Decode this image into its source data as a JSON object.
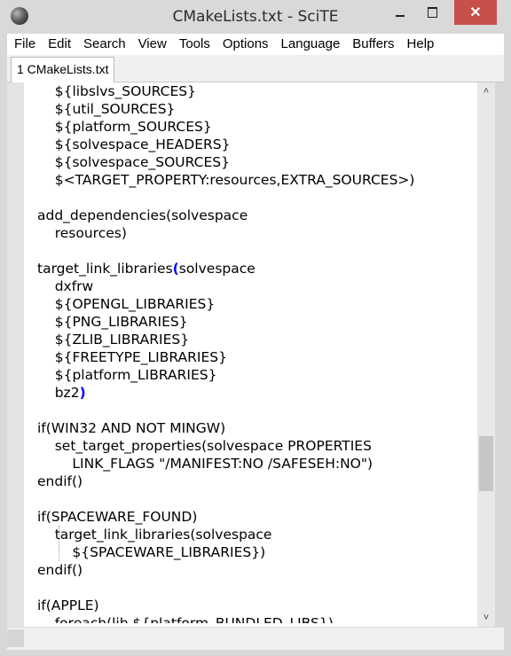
{
  "window": {
    "title": "CMakeLists.txt - SciTE",
    "close_glyph": "✕"
  },
  "menu": [
    "File",
    "Edit",
    "Search",
    "View",
    "Tools",
    "Options",
    "Language",
    "Buffers",
    "Help"
  ],
  "tabs": [
    {
      "label": "1 CMakeLists.txt",
      "active": true
    }
  ],
  "colors": {
    "brace_highlight": "#0000ff",
    "close_button": "#c7504b",
    "margin": "#e4e4e4"
  },
  "editor": {
    "lines": [
      {
        "indent": "    ",
        "text": "${libslvs_SOURCES}"
      },
      {
        "indent": "    ",
        "text": "${util_SOURCES}"
      },
      {
        "indent": "    ",
        "text": "${platform_SOURCES}"
      },
      {
        "indent": "    ",
        "text": "${solvespace_HEADERS}"
      },
      {
        "indent": "    ",
        "text": "${solvespace_SOURCES}"
      },
      {
        "indent": "    ",
        "text": "$<TARGET_PROPERTY:resources,EXTRA_SOURCES>)"
      },
      {
        "indent": "",
        "text": ""
      },
      {
        "indent": "",
        "text": "add_dependencies(solvespace"
      },
      {
        "indent": "    ",
        "text": "resources)"
      },
      {
        "indent": "",
        "text": ""
      },
      {
        "indent": "",
        "text": "target_link_libraries",
        "brace": "(",
        "after": "solvespace"
      },
      {
        "indent": "    ",
        "text": "dxfrw"
      },
      {
        "indent": "    ",
        "text": "${OPENGL_LIBRARIES}"
      },
      {
        "indent": "    ",
        "text": "${PNG_LIBRARIES}"
      },
      {
        "indent": "    ",
        "text": "${ZLIB_LIBRARIES}"
      },
      {
        "indent": "    ",
        "text": "${FREETYPE_LIBRARIES}"
      },
      {
        "indent": "    ",
        "text": "${platform_LIBRARIES}"
      },
      {
        "indent": "    ",
        "text": "bz2",
        "brace": ")",
        "after": ""
      },
      {
        "indent": "",
        "text": ""
      },
      {
        "indent": "",
        "text": "if(WIN32 AND NOT MINGW)"
      },
      {
        "indent": "    ",
        "text": "set_target_properties(solvespace PROPERTIES"
      },
      {
        "indent": "        ",
        "text": "LINK_FLAGS \"/MANIFEST:NO /SAFESEH:NO\")"
      },
      {
        "indent": "",
        "text": "endif()"
      },
      {
        "indent": "",
        "text": ""
      },
      {
        "indent": "",
        "text": "if(SPACEWARE_FOUND)"
      },
      {
        "indent": "    ",
        "text": "target_link_libraries(solvespace"
      },
      {
        "indent": "        ",
        "text": "${SPACEWARE_LIBRARIES})"
      },
      {
        "indent": "",
        "text": "endif()"
      },
      {
        "indent": "",
        "text": ""
      },
      {
        "indent": "",
        "text": "if(APPLE)"
      },
      {
        "indent": "    ",
        "text": "foreach(lib ${platform_BUNDLED_LIBS})"
      }
    ]
  },
  "scrollbar": {
    "up_glyph": "˄",
    "down_glyph": "˅",
    "position_fraction": 0.74
  },
  "icons": {
    "app": "scite-sphere-icon",
    "scroll_up": "chevron-up-icon",
    "scroll_down": "chevron-down-icon"
  }
}
